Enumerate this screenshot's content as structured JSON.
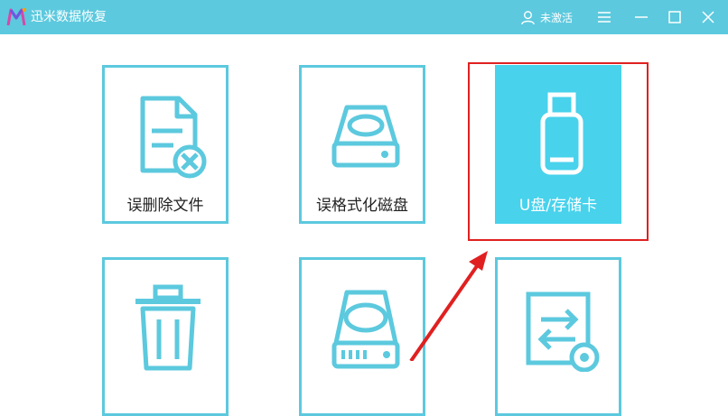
{
  "app": {
    "title": "迅米数据恢复",
    "user_label": "未激活",
    "icons": {
      "logo": "app-logo-icon",
      "user": "user-icon",
      "menu": "menu-icon",
      "minimize": "minimize-icon",
      "maximize": "maximize-icon",
      "close": "close-icon"
    }
  },
  "colors": {
    "accent": "#5cc9de",
    "selected_tile": "#48d2ec",
    "highlight_frame": "#e02020"
  },
  "tiles": [
    {
      "label": "误删除文件",
      "icon": "deleted-file-icon",
      "selected": false
    },
    {
      "label": "误格式化磁盘",
      "icon": "formatted-disk-icon",
      "selected": false
    },
    {
      "label": "U盘/存储卡",
      "icon": "usb-drive-icon",
      "selected": true
    },
    {
      "label": "",
      "icon": "trash-bin-icon",
      "selected": false
    },
    {
      "label": "",
      "icon": "hard-disk-icon",
      "selected": false
    },
    {
      "label": "",
      "icon": "transfer-settings-icon",
      "selected": false
    }
  ]
}
